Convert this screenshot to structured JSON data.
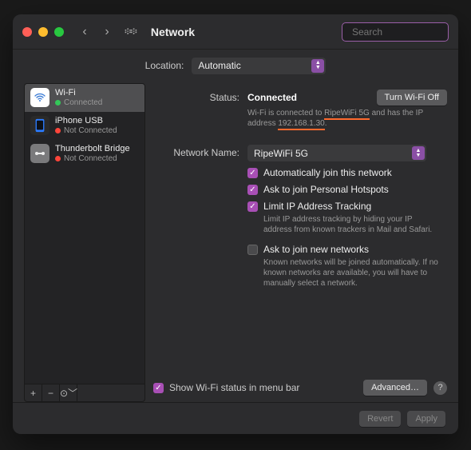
{
  "window": {
    "title": "Network"
  },
  "search": {
    "placeholder": "Search"
  },
  "location": {
    "label": "Location:",
    "value": "Automatic"
  },
  "sidebar": {
    "items": [
      {
        "name": "Wi-Fi",
        "status": "Connected"
      },
      {
        "name": "iPhone USB",
        "status": "Not Connected"
      },
      {
        "name": "Thunderbolt Bridge",
        "status": "Not Connected"
      }
    ]
  },
  "main": {
    "status_label": "Status:",
    "status_value": "Connected",
    "wifi_toggle": "Turn Wi-Fi Off",
    "status_help_pre": "Wi-Fi is connected to ",
    "status_help_net": "RipeWiFi 5G",
    "status_help_mid": " and has the IP address ",
    "status_help_ip": "192.168.1.30",
    "status_help_end": ".",
    "netname_label": "Network Name:",
    "netname_value": "RipeWiFi 5G",
    "chk_autojoin": "Automatically join this network",
    "chk_hotspot": "Ask to join Personal Hotspots",
    "chk_limitip": "Limit IP Address Tracking",
    "limitip_help": "Limit IP address tracking by hiding your IP address from known trackers in Mail and Safari.",
    "chk_asknew": "Ask to join new networks",
    "asknew_help": "Known networks will be joined automatically. If no known networks are available, you will have to manually select a network.",
    "show_menubar": "Show Wi-Fi status in menu bar",
    "advanced": "Advanced…"
  },
  "buttons": {
    "revert": "Revert",
    "apply": "Apply"
  }
}
